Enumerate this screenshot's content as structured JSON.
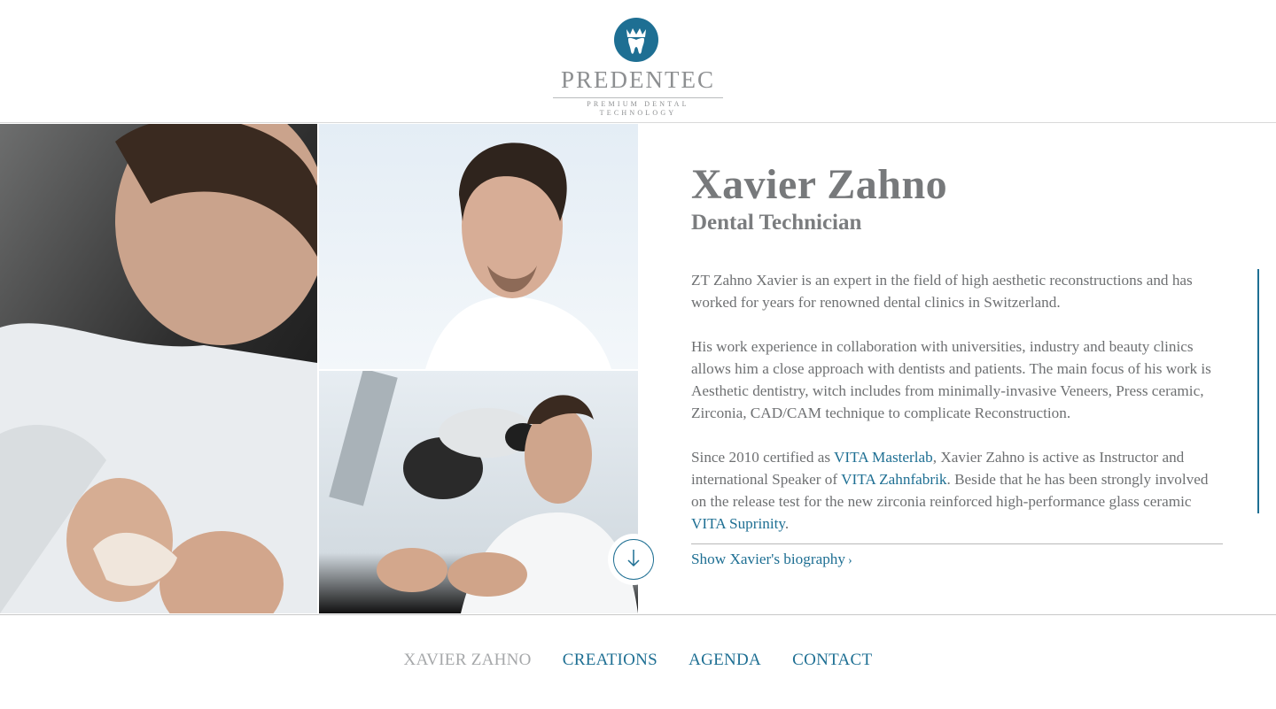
{
  "brand": {
    "name": "PREDENTEC",
    "tagline": "PREMIUM DENTAL TECHNOLOGY",
    "accent_color": "#1e6f93"
  },
  "profile": {
    "name": "Xavier Zahno",
    "role": "Dental Technician",
    "paragraph_1": "ZT Zahno Xavier is an expert in the field of high aesthetic reconstructions and has worked for years for renowned dental clinics in Switzerland.",
    "paragraph_2": "His work experience in collaboration with universities, industry and beauty clinics allows him a close approach with dentists and patients. The main focus of his work is Aesthetic dentistry, witch includes from minimally-invasive Veneers, Press ceramic, Zirconia, CAD/CAM technique to complicate Reconstruction.",
    "paragraph_3": {
      "part_1": "Since 2010 certified as ",
      "link_1": "VITA Masterlab",
      "part_2": ", Xavier Zahno is active as Instructor and international Speaker of ",
      "link_2": "VITA Zahnfabrik",
      "part_3": ". Beside that he has been strongly involved on the release test for the new zirconia reinforced high-performance glass ceramic ",
      "link_3": "VITA Suprinity",
      "part_4": "."
    },
    "biography_link": "Show Xavier's biography",
    "biography_chevron": "›"
  },
  "photos": [
    {
      "name": "technician-working-on-dental-model",
      "icon": "photo"
    },
    {
      "name": "technician-portrait",
      "icon": "photo"
    },
    {
      "name": "technician-at-microscope",
      "icon": "photo"
    }
  ],
  "scroll_button": {
    "icon": "arrow-down-icon"
  },
  "nav": {
    "items": [
      "XAVIER ZAHNO",
      "CREATIONS",
      "AGENDA",
      "CONTACT"
    ],
    "active": "XAVIER ZAHNO"
  }
}
